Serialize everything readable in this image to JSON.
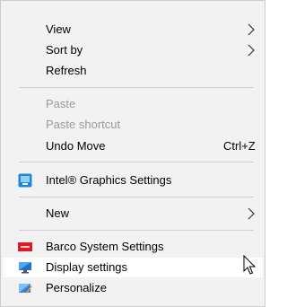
{
  "menu": {
    "view": {
      "label": "View"
    },
    "sort_by": {
      "label": "Sort by"
    },
    "refresh": {
      "label": "Refresh"
    },
    "paste": {
      "label": "Paste"
    },
    "paste_shortcut": {
      "label": "Paste shortcut"
    },
    "undo_move": {
      "label": "Undo Move",
      "shortcut": "Ctrl+Z"
    },
    "intel_graphics": {
      "label": "Intel® Graphics Settings",
      "icon": "intel-graphics-icon"
    },
    "new": {
      "label": "New"
    },
    "barco": {
      "label": "Barco System Settings",
      "icon": "barco-icon"
    },
    "display_settings": {
      "label": "Display settings",
      "icon": "display-settings-icon"
    },
    "personalize": {
      "label": "Personalize",
      "icon": "personalize-icon"
    }
  },
  "colors": {
    "menu_bg": "#f2f2f2",
    "highlight_bg": "#ffffff",
    "disabled_text": "#9a9a9a",
    "separator": "#d1d1d1",
    "barco_red": "#e01a24",
    "intel_blue": "#1e88d8"
  }
}
